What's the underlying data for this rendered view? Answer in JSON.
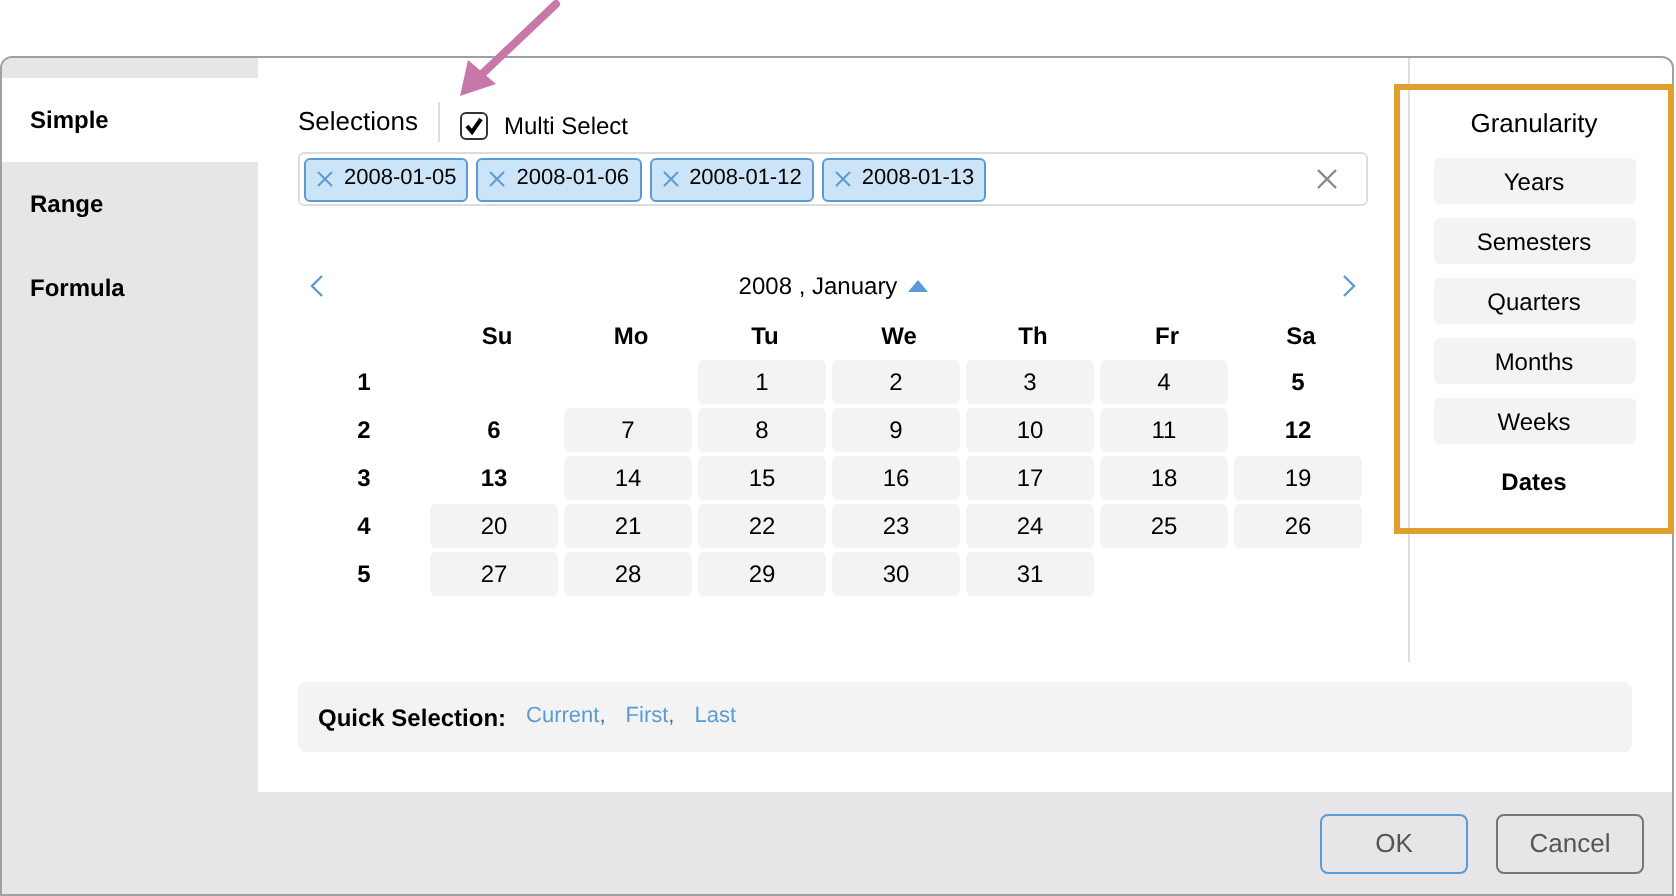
{
  "tabs": [
    {
      "label": "Simple",
      "selected": true
    },
    {
      "label": "Range",
      "selected": false
    },
    {
      "label": "Formula",
      "selected": false
    }
  ],
  "selections": {
    "label": "Selections",
    "multi_select": {
      "label": "Multi Select",
      "checked": true
    },
    "tags": [
      "2008-01-05",
      "2008-01-06",
      "2008-01-12",
      "2008-01-13"
    ]
  },
  "calendar": {
    "title": "2008 , January",
    "weekdays": [
      "Su",
      "Mo",
      "Tu",
      "We",
      "Th",
      "Fr",
      "Sa"
    ],
    "weeks": [
      {
        "number": "1",
        "days": [
          {
            "kind": "blank"
          },
          {
            "kind": "blank"
          },
          {
            "kind": "day",
            "label": "1",
            "selected": false
          },
          {
            "kind": "day",
            "label": "2",
            "selected": false
          },
          {
            "kind": "day",
            "label": "3",
            "selected": false
          },
          {
            "kind": "day",
            "label": "4",
            "selected": false
          },
          {
            "kind": "day",
            "label": "5",
            "selected": true
          }
        ]
      },
      {
        "number": "2",
        "days": [
          {
            "kind": "day",
            "label": "6",
            "selected": true
          },
          {
            "kind": "day",
            "label": "7",
            "selected": false
          },
          {
            "kind": "day",
            "label": "8",
            "selected": false
          },
          {
            "kind": "day",
            "label": "9",
            "selected": false
          },
          {
            "kind": "day",
            "label": "10",
            "selected": false
          },
          {
            "kind": "day",
            "label": "11",
            "selected": false
          },
          {
            "kind": "day",
            "label": "12",
            "selected": true
          }
        ]
      },
      {
        "number": "3",
        "days": [
          {
            "kind": "day",
            "label": "13",
            "selected": true
          },
          {
            "kind": "day",
            "label": "14",
            "selected": false
          },
          {
            "kind": "day",
            "label": "15",
            "selected": false
          },
          {
            "kind": "day",
            "label": "16",
            "selected": false
          },
          {
            "kind": "day",
            "label": "17",
            "selected": false
          },
          {
            "kind": "day",
            "label": "18",
            "selected": false
          },
          {
            "kind": "day",
            "label": "19",
            "selected": false
          }
        ]
      },
      {
        "number": "4",
        "days": [
          {
            "kind": "day",
            "label": "20",
            "selected": false
          },
          {
            "kind": "day",
            "label": "21",
            "selected": false
          },
          {
            "kind": "day",
            "label": "22",
            "selected": false
          },
          {
            "kind": "day",
            "label": "23",
            "selected": false
          },
          {
            "kind": "day",
            "label": "24",
            "selected": false
          },
          {
            "kind": "day",
            "label": "25",
            "selected": false
          },
          {
            "kind": "day",
            "label": "26",
            "selected": false
          }
        ]
      },
      {
        "number": "5",
        "days": [
          {
            "kind": "day",
            "label": "27",
            "selected": false
          },
          {
            "kind": "day",
            "label": "28",
            "selected": false
          },
          {
            "kind": "day",
            "label": "29",
            "selected": false
          },
          {
            "kind": "day",
            "label": "30",
            "selected": false
          },
          {
            "kind": "day",
            "label": "31",
            "selected": false
          },
          {
            "kind": "blank"
          },
          {
            "kind": "blank"
          }
        ]
      }
    ]
  },
  "quick_selection": {
    "label": "Quick Selection:",
    "links": [
      "Current",
      "First",
      "Last"
    ],
    "separator": ","
  },
  "granularity": {
    "title": "Granularity",
    "options": [
      {
        "label": "Years",
        "selected": false
      },
      {
        "label": "Semesters",
        "selected": false
      },
      {
        "label": "Quarters",
        "selected": false
      },
      {
        "label": "Months",
        "selected": false
      },
      {
        "label": "Weeks",
        "selected": false
      },
      {
        "label": "Dates",
        "selected": true
      }
    ]
  },
  "buttons": [
    "OK",
    "Cancel"
  ]
}
